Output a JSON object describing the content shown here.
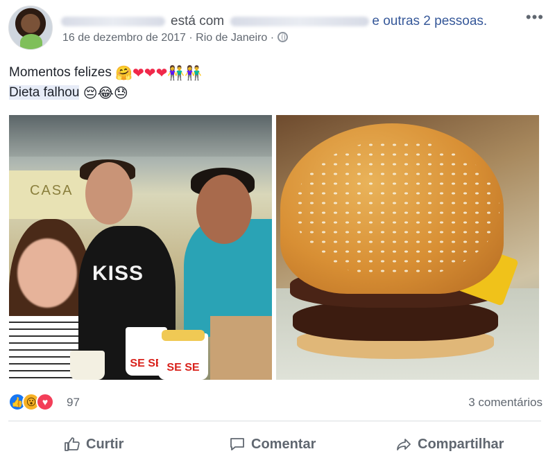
{
  "post": {
    "with_text": "está com",
    "and_others": "e outras 2 pessoas.",
    "date": "16 de dezembro de 2017",
    "sep": "·",
    "location": "Rio de Janeiro",
    "more_glyph": "•••",
    "line1_text": "Momentos felizes",
    "line2_text": "Dieta falhou",
    "photo1_store_sign": "CASA",
    "photo1_shirt_text": "KISS",
    "photo1_cup_text": "SE SE"
  },
  "footer": {
    "reaction_count": "97",
    "comments": "3 comentários",
    "like_label": "Curtir",
    "comment_label": "Comentar",
    "share_label": "Compartilhar"
  },
  "icons": [
    "avatar",
    "globe-icon",
    "more-icon",
    "like-reaction-icon",
    "wow-reaction-icon",
    "love-reaction-icon",
    "like-icon",
    "comment-icon",
    "share-icon"
  ],
  "colors": {
    "link": "#365899",
    "like_blue": "#1877f2",
    "love_red": "#f33e58",
    "wow_yellow": "#f7b125",
    "text_gray": "#606770"
  }
}
